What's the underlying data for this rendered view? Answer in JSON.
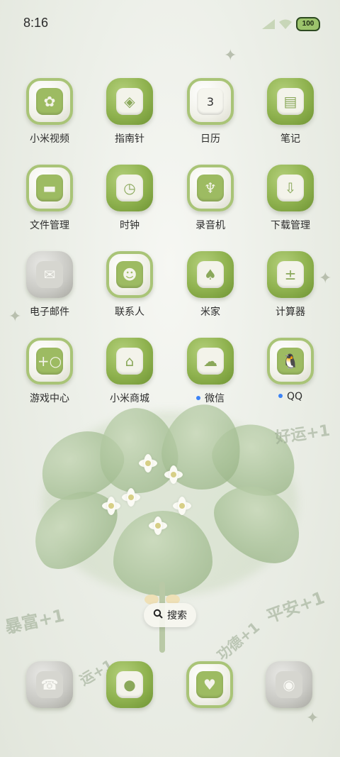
{
  "status_bar": {
    "time": "8:16",
    "battery": "100"
  },
  "apps": [
    {
      "label": "小米视频",
      "icon": "film-reel-icon",
      "style": "white"
    },
    {
      "label": "指南针",
      "icon": "compass-icon",
      "style": "green"
    },
    {
      "label": "日历",
      "icon": "calendar-icon",
      "style": "white",
      "date": "3"
    },
    {
      "label": "笔记",
      "icon": "notebook-icon",
      "style": "green"
    },
    {
      "label": "文件管理",
      "icon": "folder-icon",
      "style": "white"
    },
    {
      "label": "时钟",
      "icon": "alarm-clock-icon",
      "style": "green"
    },
    {
      "label": "录音机",
      "icon": "microphone-icon",
      "style": "white"
    },
    {
      "label": "下载管理",
      "icon": "download-cloud-icon",
      "style": "green"
    },
    {
      "label": "电子邮件",
      "icon": "mail-icon",
      "style": "gray"
    },
    {
      "label": "联系人",
      "icon": "contact-card-icon",
      "style": "white"
    },
    {
      "label": "米家",
      "icon": "mushroom-icon",
      "style": "green"
    },
    {
      "label": "计算器",
      "icon": "calculator-icon",
      "style": "green"
    },
    {
      "label": "游戏中心",
      "icon": "gamepad-icon",
      "style": "white"
    },
    {
      "label": "小米商城",
      "icon": "shop-icon",
      "style": "green"
    },
    {
      "label": "微信",
      "icon": "wechat-icon",
      "style": "green",
      "badge_dot": true
    },
    {
      "label": "QQ",
      "icon": "penguin-icon",
      "style": "white",
      "badge_dot": true
    }
  ],
  "search": {
    "label": "搜索"
  },
  "dock": [
    {
      "icon": "phone-icon",
      "style": "gray"
    },
    {
      "icon": "chat-bubble-icon",
      "style": "green"
    },
    {
      "icon": "heart-message-icon",
      "style": "white"
    },
    {
      "icon": "camera-icon",
      "style": "gray"
    }
  ],
  "wallpaper_text": {
    "fortune": "好运+1",
    "wealth": "暴富+1",
    "peace": "平安+1",
    "merit": "功德+1",
    "luck": "运+1"
  },
  "colors": {
    "accent_green": "#8fb24f",
    "badge_blue": "#3b82f6"
  }
}
